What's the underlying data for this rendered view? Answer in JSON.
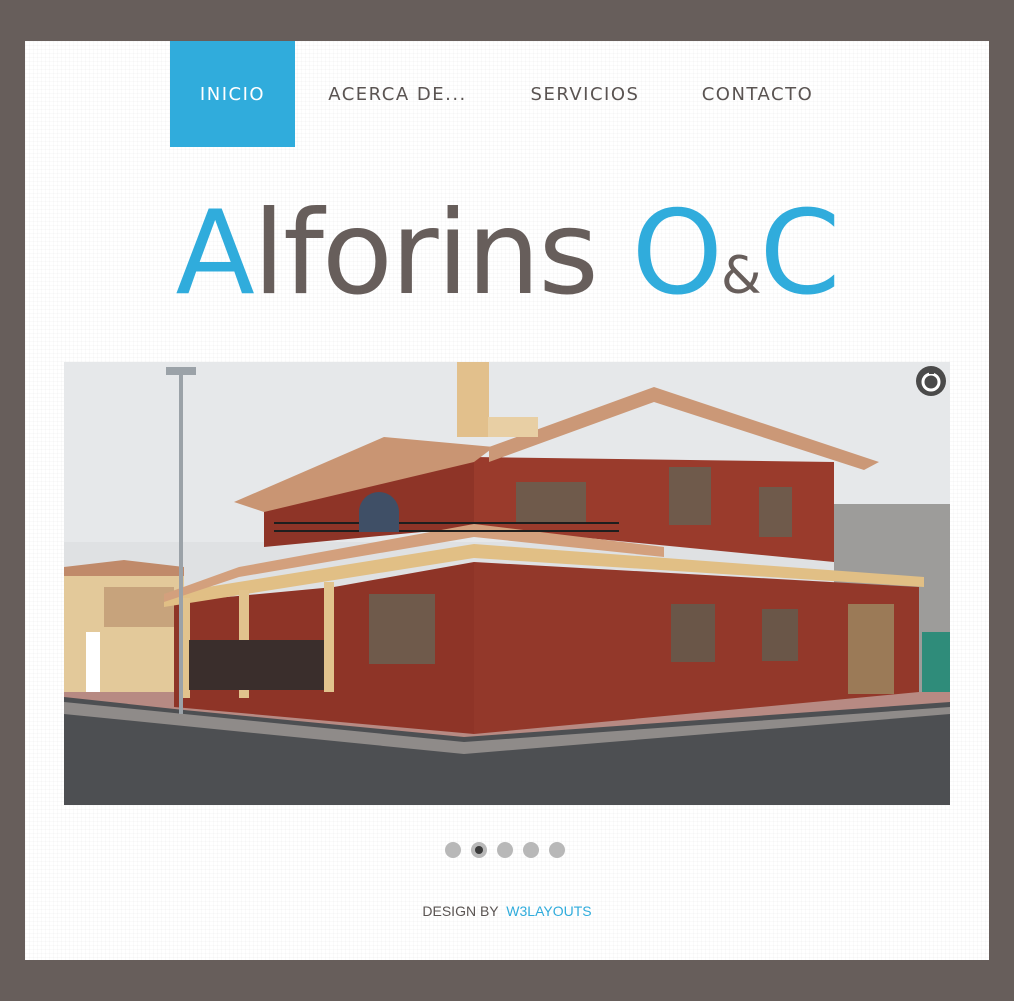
{
  "nav": {
    "items": [
      {
        "label": "INICIO",
        "active": true
      },
      {
        "label": "ACERCA DE..."
      },
      {
        "label": "SERVICIOS"
      },
      {
        "label": "CONTACTO"
      }
    ]
  },
  "logo": {
    "letter_a": "A",
    "rest_alforins": "lforins",
    "letter_o": "O",
    "amp": "&",
    "letter_c": "C"
  },
  "slider": {
    "image_icon": "house-photo",
    "pause_icon": "pause-icon",
    "active_index": 2,
    "total": 5
  },
  "footer": {
    "design_by": "DESIGN BY",
    "link": "W3LAYOUTS"
  },
  "colors": {
    "accent": "#30acdc",
    "brand_gray": "#675e5b",
    "background": "#ffffff"
  }
}
